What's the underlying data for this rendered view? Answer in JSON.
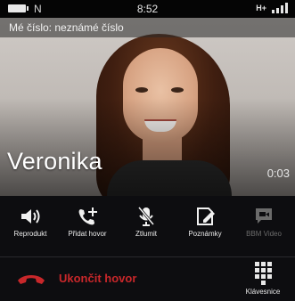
{
  "status_bar": {
    "time": "8:52",
    "nfc_label": "N",
    "network": "H+"
  },
  "caller_id": {
    "text": "Mé číslo: neznámé číslo"
  },
  "contact": {
    "name": "Veronika",
    "duration": "0:03"
  },
  "controls": {
    "speaker_label": "Reprodukt",
    "add_call_label": "Přidat hovor",
    "mute_label": "Ztlumit",
    "notes_label": "Poznámky",
    "bbm_video_label": "BBM Video",
    "end_call_label": "Ukončit hovor",
    "keypad_label": "Klávesnice"
  },
  "colors": {
    "end_call": "#c8272a",
    "background": "#0d0d10",
    "disabled": "#6b6b6b"
  },
  "icons": [
    "battery-icon",
    "nfc-icon",
    "signal-icon",
    "speaker-icon",
    "add-call-icon",
    "mute-icon",
    "notes-icon",
    "bbm-video-icon",
    "end-call-icon",
    "keypad-icon"
  ]
}
